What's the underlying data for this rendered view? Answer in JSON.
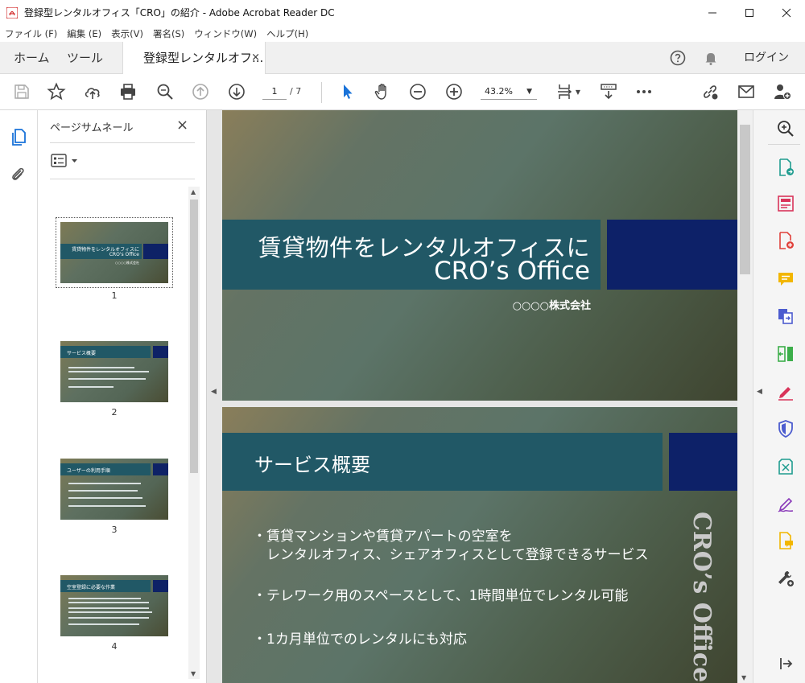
{
  "window": {
    "title": "登録型レンタルオフィス「CRO」の紹介 - Adobe Acrobat Reader DC"
  },
  "menu": [
    "ファイル (F)",
    "編集 (E)",
    "表示(V)",
    "署名(S)",
    "ウィンドウ(W)",
    "ヘルプ(H)"
  ],
  "tabs": {
    "home": "ホーム",
    "tools": "ツール",
    "document": "登録型レンタルオフ...",
    "close": "×",
    "login": "ログイン"
  },
  "toolbar": {
    "current_page": "1",
    "total_pages": "/ 7",
    "zoom": "43.2%"
  },
  "thumbnail_panel": {
    "title": "ページサムネール",
    "close": "×",
    "pages": [
      {
        "number": "1",
        "title": "賃貸物件をレンタルオフィスに",
        "subtitle": "CRO's Office",
        "company": "○○○○株式会社"
      },
      {
        "number": "2",
        "title": "サービス概要"
      },
      {
        "number": "3",
        "title": "ユーザーの利用手順"
      },
      {
        "number": "4",
        "title": "空室登録に必要な作業"
      }
    ]
  },
  "document": {
    "slide1": {
      "title_line1": "賃貸物件をレンタルオフィスに",
      "title_line2": "CRO’s Office",
      "company": "○○○○株式会社"
    },
    "slide2": {
      "heading": "サービス概要",
      "bullets": [
        "・賃貸マンションや賃貸アパートの空室を",
        "　レンタルオフィス、シェアオフィスとして登録できるサービス",
        "・テレワーク用のスペースとして、1時間単位でレンタル可能",
        "・1カ月単位でのレンタルにも対応"
      ],
      "side_text": "CRO’s Office"
    }
  },
  "colors": {
    "slide_bar": "#215866",
    "slide_navy": "#0d2168",
    "accent_blue": "#1a73d9"
  }
}
